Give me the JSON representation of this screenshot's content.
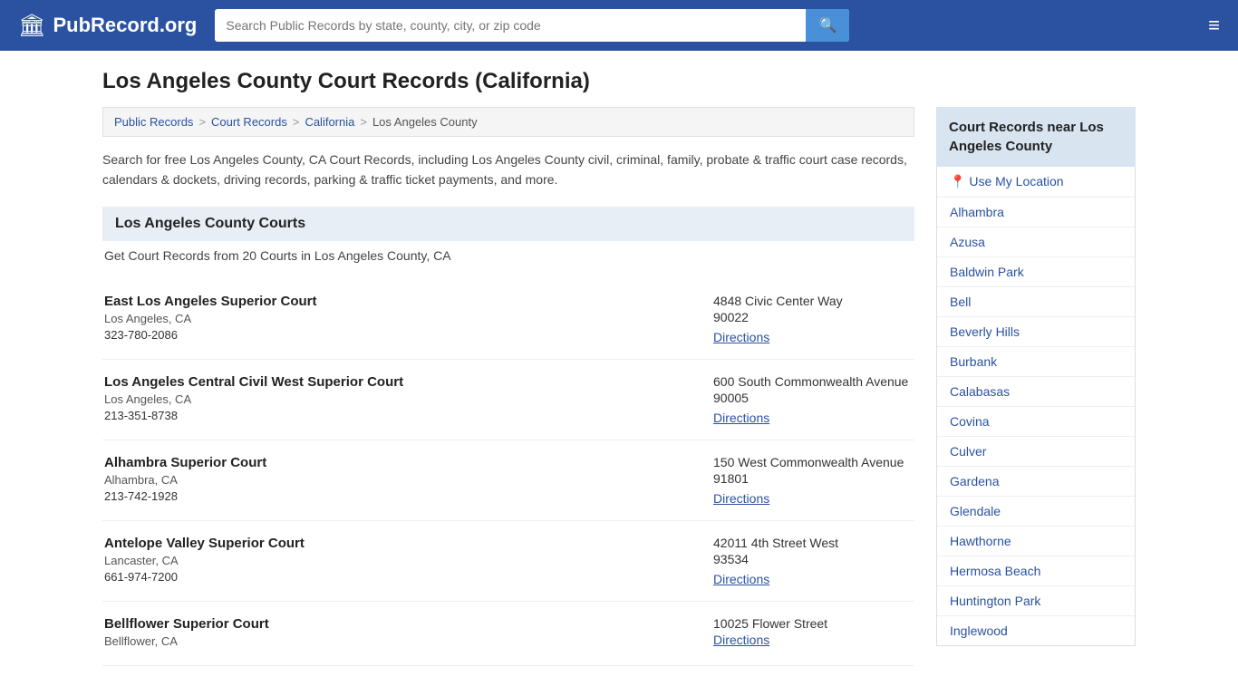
{
  "header": {
    "logo_icon": "🏛",
    "logo_text": "PubRecord.org",
    "search_placeholder": "Search Public Records by state, county, city, or zip code",
    "search_value": "",
    "menu_icon": "≡"
  },
  "page": {
    "title": "Los Angeles County Court Records (California)"
  },
  "breadcrumb": {
    "items": [
      "Public Records",
      "Court Records",
      "California",
      "Los Angeles County"
    ]
  },
  "description": "Search for free Los Angeles County, CA Court Records, including Los Angeles County civil, criminal, family, probate & traffic court case records, calendars & dockets, driving records, parking & traffic ticket payments, and more.",
  "section": {
    "heading": "Los Angeles County Courts",
    "sub_heading": "Get Court Records from 20 Courts in Los Angeles County, CA"
  },
  "courts": [
    {
      "name": "East Los Angeles Superior Court",
      "location": "Los Angeles, CA",
      "phone": "323-780-2086",
      "address_street": "4848 Civic Center Way",
      "address_zip": "90022",
      "directions_label": "Directions"
    },
    {
      "name": "Los Angeles Central Civil West Superior Court",
      "location": "Los Angeles, CA",
      "phone": "213-351-8738",
      "address_street": "600 South Commonwealth Avenue",
      "address_zip": "90005",
      "directions_label": "Directions"
    },
    {
      "name": "Alhambra Superior Court",
      "location": "Alhambra, CA",
      "phone": "213-742-1928",
      "address_street": "150 West Commonwealth Avenue",
      "address_zip": "91801",
      "directions_label": "Directions"
    },
    {
      "name": "Antelope Valley Superior Court",
      "location": "Lancaster, CA",
      "phone": "661-974-7200",
      "address_street": "42011 4th Street West",
      "address_zip": "93534",
      "directions_label": "Directions"
    },
    {
      "name": "Bellflower Superior Court",
      "location": "Bellflower, CA",
      "phone": "",
      "address_street": "10025 Flower Street",
      "address_zip": "",
      "directions_label": "Directions"
    }
  ],
  "sidebar": {
    "title": "Court Records near Los Angeles County",
    "use_location_label": "Use My Location",
    "nearby_cities": [
      "Alhambra",
      "Azusa",
      "Baldwin Park",
      "Bell",
      "Beverly Hills",
      "Burbank",
      "Calabasas",
      "Covina",
      "Culver",
      "Gardena",
      "Glendale",
      "Hawthorne",
      "Hermosa Beach",
      "Huntington Park",
      "Inglewood"
    ]
  }
}
